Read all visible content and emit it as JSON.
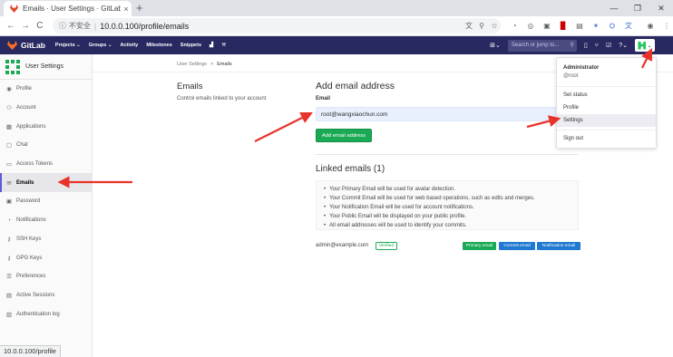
{
  "browser": {
    "tab_title": "Emails · User Settings · GitLab",
    "tab_close": "×",
    "new_tab": "+",
    "window_controls": [
      "—",
      "❐",
      "✕"
    ],
    "nav_buttons": [
      "←",
      "→",
      "C"
    ],
    "security_label": "不安全",
    "url": "10.0.0.100/profile/emails",
    "status_url": "10.0.0.100/profile"
  },
  "gitlab_nav": {
    "brand": "GitLab",
    "menu": [
      "Projects ⌄",
      "Groups ⌄",
      "Activity",
      "Milestones",
      "Snippets"
    ],
    "search_placeholder": "Search or jump to..."
  },
  "sidebar": {
    "title": "User Settings",
    "items": [
      {
        "label": "Profile",
        "icon": "user-icon"
      },
      {
        "label": "Account",
        "icon": "people-icon"
      },
      {
        "label": "Applications",
        "icon": "grid-icon"
      },
      {
        "label": "Chat",
        "icon": "chat-icon"
      },
      {
        "label": "Access Tokens",
        "icon": "token-icon"
      },
      {
        "label": "Emails",
        "icon": "mail-icon"
      },
      {
        "label": "Password",
        "icon": "lock-icon"
      },
      {
        "label": "Notifications",
        "icon": "bell-icon"
      },
      {
        "label": "SSH Keys",
        "icon": "key-icon"
      },
      {
        "label": "GPG Keys",
        "icon": "key-icon"
      },
      {
        "label": "Preferences",
        "icon": "sliders-icon"
      },
      {
        "label": "Active Sessions",
        "icon": "monitor-icon"
      },
      {
        "label": "Authentication log",
        "icon": "list-icon"
      }
    ]
  },
  "breadcrumb": {
    "parent": "User Settings",
    "separator": ">",
    "current": "Emails"
  },
  "section": {
    "title": "Emails",
    "description": "Control emails linked to your account"
  },
  "add_email": {
    "title": "Add email address",
    "label": "Email",
    "value": "root@wangxiaochun.com",
    "button": "Add email address"
  },
  "linked": {
    "title": "Linked emails (1)",
    "notes": [
      "Your Primary Email will be used for avatar detection.",
      "Your Commit Email will be used for web based operations, such as edits and merges.",
      "Your Notification Email will be used for account notifications.",
      "Your Public Email will be displayed on your public profile.",
      "All email addresses will be used to identify your commits."
    ],
    "email": "admin@example.com",
    "verified": "Verified",
    "badges": [
      "Primary email",
      "Commit email",
      "Notification email"
    ]
  },
  "user_dropdown": {
    "name": "Administrator",
    "handle": "@root",
    "items": [
      "Set status",
      "Profile",
      "Settings",
      "Sign out"
    ]
  },
  "colors": {
    "navbar": "#292961",
    "accent_green": "#1aaa55",
    "badge_blue": "#1f78d1",
    "annotation_red": "#e8332a"
  }
}
